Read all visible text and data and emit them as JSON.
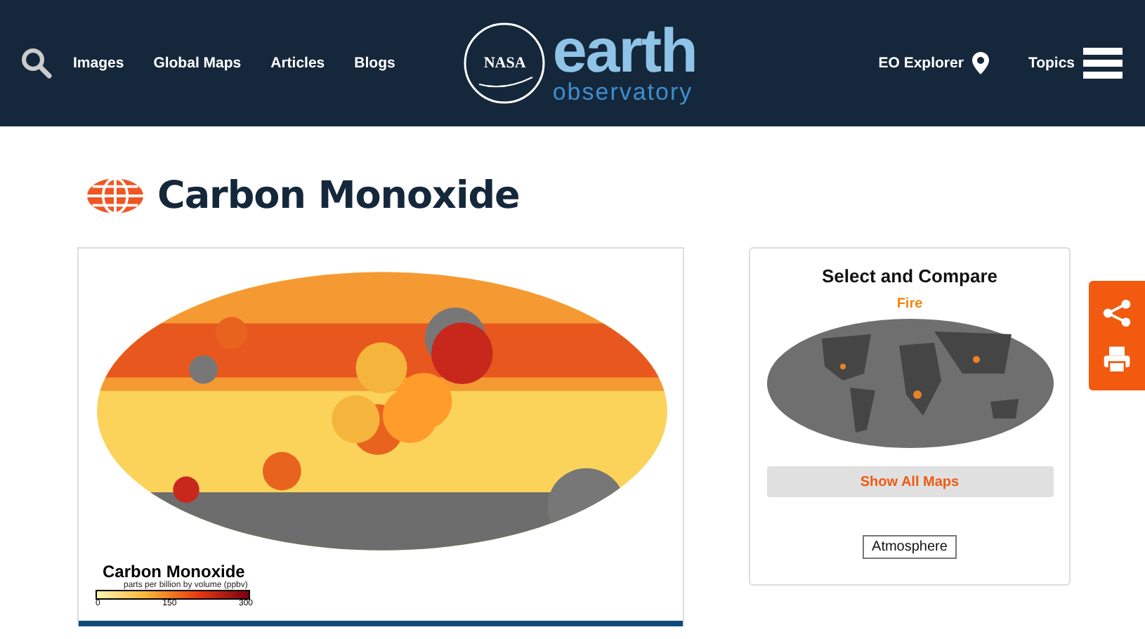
{
  "header": {
    "nav": [
      "Images",
      "Global Maps",
      "Articles",
      "Blogs"
    ],
    "logo": {
      "agency": "NASA",
      "word": "earth",
      "sub": "observatory"
    },
    "right": [
      {
        "label": "EO Explorer",
        "kind": "pin"
      },
      {
        "label": "Topics",
        "kind": "menu"
      }
    ]
  },
  "page": {
    "title": "Carbon Monoxide"
  },
  "figure": {
    "kind": "picture",
    "legend": {
      "title": "Carbon Monoxide",
      "unit": "parts per billion by volume (ppbv)",
      "ticks": [
        "0",
        "150",
        "300"
      ]
    }
  },
  "compare": {
    "title": "Select and Compare",
    "map_name": "Fire",
    "button": "Show All Maps",
    "tag": "Atmosphere"
  },
  "side_tools": [
    {
      "kind": "share"
    },
    {
      "kind": "print"
    }
  ]
}
